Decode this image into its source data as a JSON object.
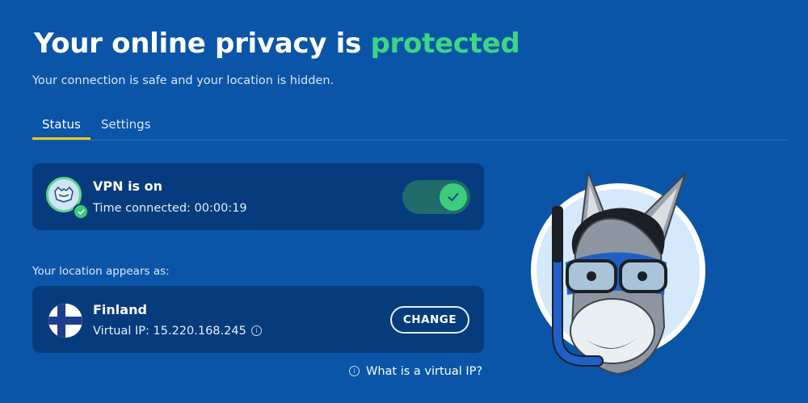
{
  "header": {
    "title_prefix": "Your online privacy is",
    "title_accent": "protected",
    "subtitle": "Your connection is safe and your location is hidden."
  },
  "tabs": [
    {
      "label": "Status",
      "active": true
    },
    {
      "label": "Settings",
      "active": false
    }
  ],
  "vpn_status": {
    "title": "VPN is on",
    "time_label": "Time connected: 00:00:19",
    "toggle_on": true
  },
  "location": {
    "section_label": "Your location appears as:",
    "country": "Finland",
    "virtual_ip_label": "Virtual IP: 15.220.168.245",
    "change_label": "CHANGE"
  },
  "help_link": "What is a virtual IP?",
  "icons": {
    "avatar": "vpn-shield-icon",
    "connected_check": "check-icon",
    "toggle_check": "check-icon",
    "flag": "finland-flag-icon",
    "info": "info-icon",
    "mascot": "donkey-snorkel-mascot"
  },
  "colors": {
    "background": "#0a55a8",
    "card": "#063c7d",
    "accent_green": "#3cd684",
    "tab_underline": "#f5c518"
  }
}
